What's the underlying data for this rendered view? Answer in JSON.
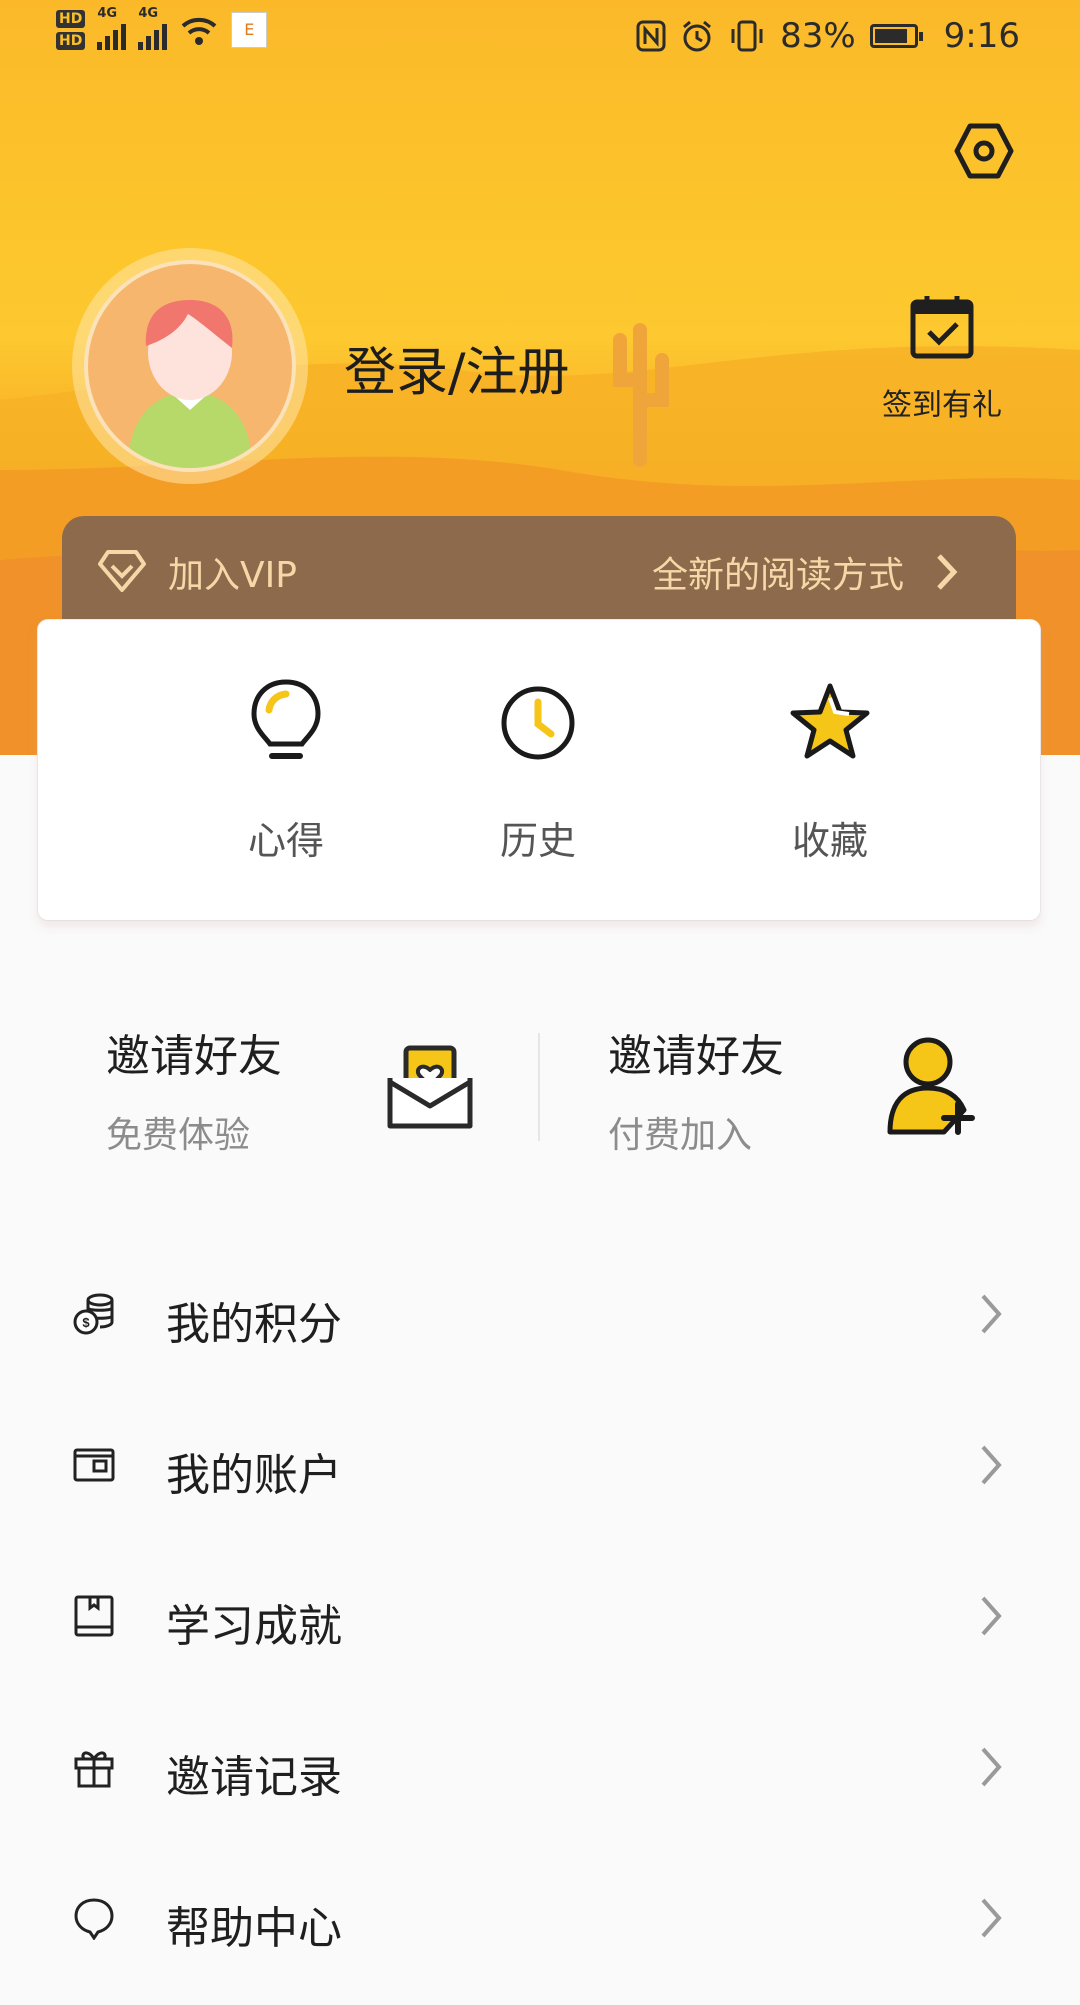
{
  "status_bar": {
    "network": "4G",
    "battery_percent": "83%",
    "time": "9:16",
    "battery_level": 0.83
  },
  "profile": {
    "login_label": "登录/注册",
    "checkin_label": "签到有礼"
  },
  "vip": {
    "title": "加入VIP",
    "subtitle": "全新的阅读方式"
  },
  "quick_actions": [
    {
      "icon": "lightbulb-icon",
      "label": "心得"
    },
    {
      "icon": "clock-icon",
      "label": "历史"
    },
    {
      "icon": "star-icon",
      "label": "收藏"
    }
  ],
  "invite": [
    {
      "title": "邀请好友",
      "subtitle": "免费体验",
      "icon": "envelope-heart-icon"
    },
    {
      "title": "邀请好友",
      "subtitle": "付费加入",
      "icon": "add-user-icon"
    }
  ],
  "menu": [
    {
      "icon": "coins-icon",
      "label": "我的积分"
    },
    {
      "icon": "wallet-icon",
      "label": "我的账户"
    },
    {
      "icon": "book-icon",
      "label": "学习成就"
    },
    {
      "icon": "gift-icon",
      "label": "邀请记录"
    },
    {
      "icon": "help-icon",
      "label": "帮助中心"
    }
  ],
  "colors": {
    "accent_yellow": "#fcc52b",
    "vip_brown": "#8c6a4b",
    "vip_text": "#f6d8a8"
  }
}
